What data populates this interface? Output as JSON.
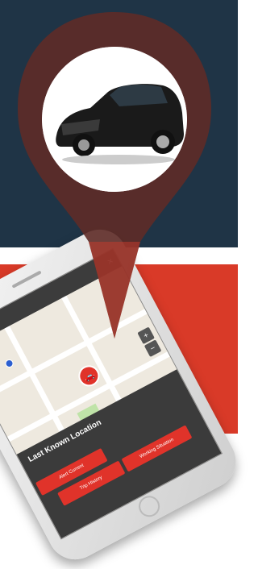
{
  "app": {
    "menu_icon": "hamburger-icon",
    "close_icon": "close-icon"
  },
  "info": {
    "heading": "Last Known Location",
    "address": "",
    "buttons": [
      "",
      "Alert Current",
      "Trip History",
      "Working Situation"
    ]
  },
  "colors": {
    "navy": "#1f3446",
    "red": "#d93a28",
    "pin": "#5e2b27",
    "marker": "#e0332a"
  }
}
